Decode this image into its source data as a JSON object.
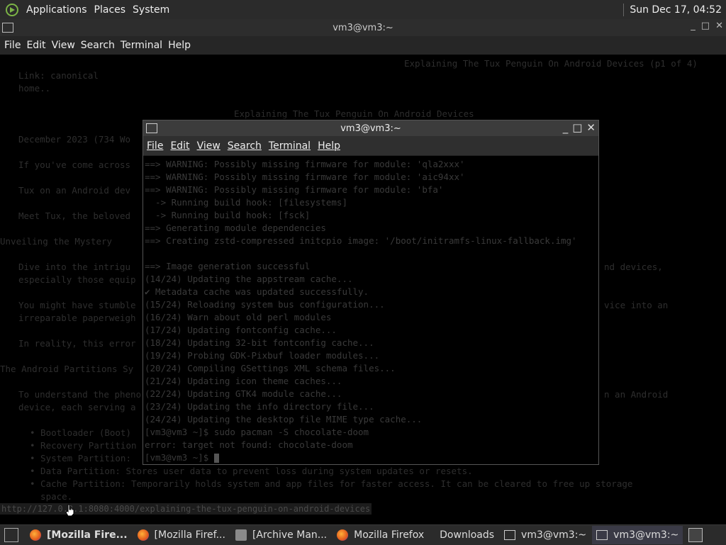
{
  "top_panel": {
    "menus": [
      "Applications",
      "Places",
      "System"
    ],
    "clock": "Sun Dec 17, 04:52"
  },
  "bg_window": {
    "title": "vm3@vm3:~",
    "buttons": [
      "_",
      "□",
      "✕"
    ],
    "menu": [
      "File",
      "Edit",
      "View",
      "Search",
      "Terminal",
      "Help"
    ],
    "lines": [
      {
        "t": "Explaining The Tux Penguin On Android Devices (p1 of 4)"
      },
      {
        "t": "Link: canonical"
      },
      {
        "t": "home.."
      },
      {
        "t": "Explaining The Tux Penguin On Android Devices"
      },
      {
        "t": "December 2023 (734 Wo"
      },
      {
        "t": "If you've come across"
      },
      {
        "t": "Tux on an Android dev"
      },
      {
        "t": "Meet Tux, the beloved"
      },
      {
        "t": "Unveiling the Mystery"
      },
      {
        "t": "Dive into the intrigu"
      },
      {
        "t": "nd devices,"
      },
      {
        "t": "especially those equip"
      },
      {
        "t": "You might have stumble"
      },
      {
        "t": "vice into an"
      },
      {
        "t": "irreparable paperweigh"
      },
      {
        "t": "In reality, this error"
      },
      {
        "t": "The Android Partitions Sy"
      },
      {
        "t": "To understand the pheno"
      },
      {
        "t": "n an Android"
      },
      {
        "t": "device, each serving a"
      },
      {
        "t": "• Bootloader (Boot)"
      },
      {
        "t": "• Recovery Partition"
      },
      {
        "t": "• System Partition:"
      },
      {
        "t": "• Data Partition: Stores user data to prevent loss during system updates or resets."
      },
      {
        "t": "• Cache Partition: Temporarily holds system and app files for faster access. It can be cleared to free up storage"
      },
      {
        "t": "  space."
      }
    ],
    "status_url": "http://127.0.0.1:8080:4000/explaining-the-tux-penguin-on-android-devices"
  },
  "fg_window": {
    "title": "vm3@vm3:~",
    "buttons": [
      "_",
      "□",
      "✕"
    ],
    "menu": [
      "File",
      "Edit",
      "View",
      "Search",
      "Terminal",
      "Help"
    ],
    "lines": [
      "==> WARNING: Possibly missing firmware for module: 'qla2xxx'",
      "==> WARNING: Possibly missing firmware for module: 'aic94xx'",
      "==> WARNING: Possibly missing firmware for module: 'bfa'",
      "  -> Running build hook: [filesystems]",
      "  -> Running build hook: [fsck]",
      "==> Generating module dependencies",
      "==> Creating zstd-compressed initcpio image: '/boot/initramfs-linux-fallback.img'",
      "",
      "==> Image generation successful",
      "(14/24) Updating the appstream cache...",
      "✔ Metadata cache was updated successfully.",
      "(15/24) Reloading system bus configuration...",
      "(16/24) Warn about old perl modules",
      "(17/24) Updating fontconfig cache...",
      "(18/24) Updating 32-bit fontconfig cache...",
      "(19/24) Probing GDK-Pixbuf loader modules...",
      "(20/24) Compiling GSettings XML schema files...",
      "(21/24) Updating icon theme caches...",
      "(22/24) Updating GTK4 module cache...",
      "(23/24) Updating the info directory file...",
      "(24/24) Updating the desktop file MIME type cache...",
      "[vm3@vm3 ~]$ sudo pacman -S chocolate-doom",
      "error: target not found: chocolate-doom",
      "[vm3@vm3 ~]$ "
    ]
  },
  "taskbar": {
    "items": [
      {
        "label": "[Mozilla Fire...",
        "icon": "firefox-icon",
        "bold": true
      },
      {
        "label": "[Mozilla Firef...",
        "icon": "firefox-icon"
      },
      {
        "label": "[Archive Man...",
        "icon": "archive-icon"
      },
      {
        "label": "Mozilla Firefox",
        "icon": "firefox-icon"
      },
      {
        "label": "Downloads",
        "icon": "folder-icon"
      },
      {
        "label": "vm3@vm3:~",
        "icon": "terminal-icon"
      },
      {
        "label": "vm3@vm3:~",
        "icon": "terminal-icon",
        "active": true
      }
    ]
  }
}
